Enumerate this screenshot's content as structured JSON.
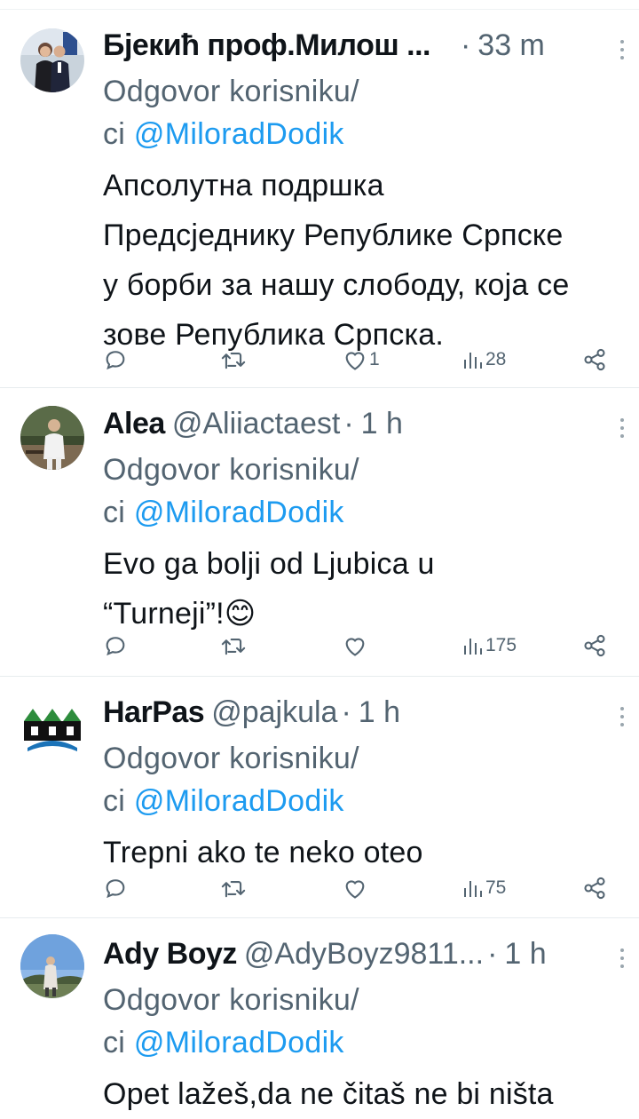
{
  "tweets": [
    {
      "name": "Бјекић проф.Милош ...",
      "handle": "",
      "time": "33 m",
      "reply_prefix": "Odgovor korisniku/",
      "reply_suffix": "ci ",
      "mention": "@MiloradDodik",
      "text_lines": [
        "Апсолутна подршка",
        "Предсједнику Републике Српске",
        "у борби за нашу слободу, која се",
        "зове Република Српска."
      ],
      "likes": "1",
      "views": "28",
      "avatar_icon": "profile-photo-icon"
    },
    {
      "name": "Alea",
      "handle": "@Aliiactaest",
      "time": "1 h",
      "reply_prefix": "Odgovor korisniku/",
      "reply_suffix": "ci ",
      "mention": "@MiloradDodik",
      "text_lines": [
        "Evo ga bolji od Ljubica u",
        "“Turneji”!😊"
      ],
      "likes": "",
      "views": "175",
      "avatar_icon": "profile-photo-icon"
    },
    {
      "name": "HarPas",
      "handle": "@pajkula",
      "time": "1 h",
      "reply_prefix": "Odgovor korisniku/",
      "reply_suffix": "ci ",
      "mention": "@MiloradDodik",
      "text_lines": [
        "Trepni ako te neko oteo"
      ],
      "likes": "",
      "views": "75",
      "avatar_icon": "bridge-logo-icon"
    },
    {
      "name": "Ady Boyz",
      "handle": "@AdyBoyz9811...",
      "time": "1 h",
      "reply_prefix": "Odgovor korisniku/",
      "reply_suffix": "ci ",
      "mention": "@MiloradDodik",
      "text_lines": [
        "Opet lažeš,da ne čitaš ne bi ništa"
      ],
      "likes": "",
      "views": "",
      "avatar_icon": "profile-photo-icon"
    }
  ],
  "separator": "·",
  "colors": {
    "mention": "#1d9bf0",
    "meta": "#536471",
    "text": "#0f1419"
  }
}
